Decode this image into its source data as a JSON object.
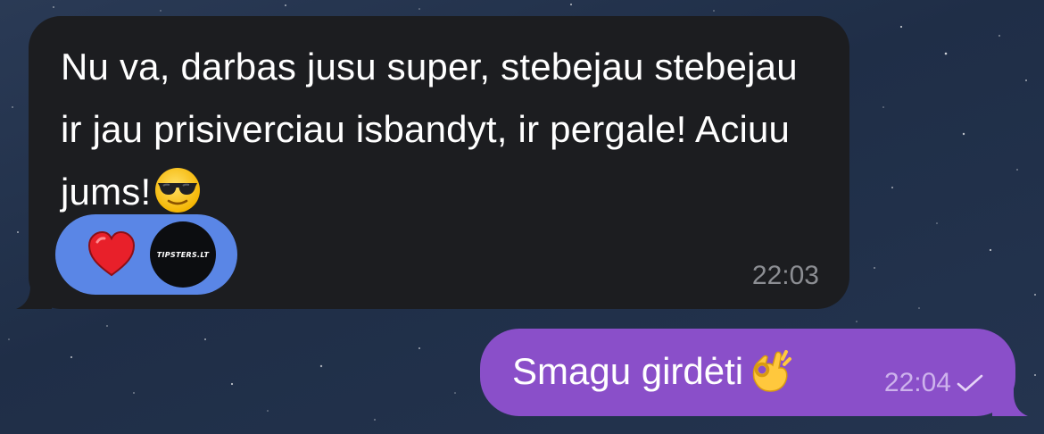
{
  "messages": [
    {
      "direction": "incoming",
      "text": "Nu va, darbas jusu super, stebejau stebejau ir jau prisiverciau isbandyt, ir pergale! Aciuu jums!",
      "emoji": "smiling-face-with-sunglasses",
      "reactions": {
        "emoji": "red-heart",
        "reactor_avatar_text": "TIPSTERS.LT"
      },
      "time": "22:03"
    },
    {
      "direction": "outgoing",
      "text": "Smagu girdėti",
      "emoji": "ok-hand",
      "time": "22:04",
      "status": "sent-single-check"
    }
  ],
  "colors": {
    "background": "#24344f",
    "incoming_bubble": "#1c1d20",
    "outgoing_bubble": "#8a4fc9",
    "reaction_pill": "#5a86e6",
    "incoming_time": "#8c8e93",
    "outgoing_meta": "#cdb2ec"
  }
}
